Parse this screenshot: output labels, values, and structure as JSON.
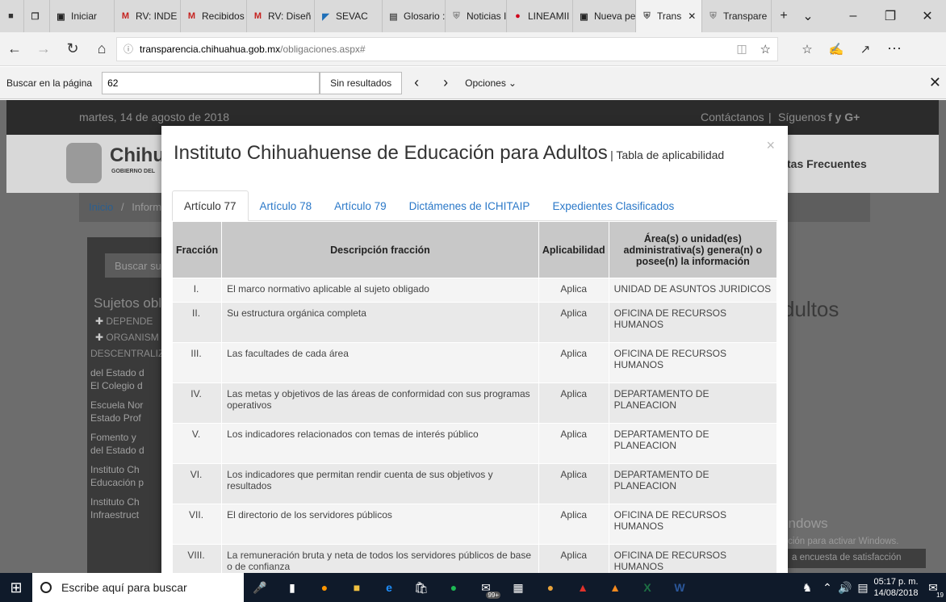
{
  "browser": {
    "tabs": [
      {
        "label": "",
        "icon": "tab-actions-icon",
        "color": "#333"
      },
      {
        "label": "",
        "icon": "back-tabs-icon",
        "color": "#333"
      },
      {
        "label": "Iniciar",
        "icon": "ichitaip-icon",
        "color": "#222"
      },
      {
        "label": "RV: INDE",
        "icon": "gmail-icon",
        "color": "#c5221f"
      },
      {
        "label": "Recibidos",
        "icon": "gmail-icon",
        "color": "#c5221f"
      },
      {
        "label": "RV: Diseñ",
        "icon": "gmail-icon",
        "color": "#c5221f"
      },
      {
        "label": "SEVAC",
        "icon": "sevac-icon",
        "color": "#1e6fb8"
      },
      {
        "label": "Glosario :",
        "icon": "page-icon",
        "color": "#555"
      },
      {
        "label": "Noticias I",
        "icon": "shield-icon",
        "color": "#888"
      },
      {
        "label": "LINEAMII",
        "icon": "red-circle-icon",
        "color": "#d0021b"
      },
      {
        "label": "Nueva pe",
        "icon": "ichitaip-icon",
        "color": "#222"
      },
      {
        "label": "Trans",
        "icon": "shield-icon",
        "color": "#555",
        "active": true
      },
      {
        "label": "Transpare",
        "icon": "shield-icon",
        "color": "#888"
      }
    ],
    "url_domain": "transparencia.chihuahua.gob.mx",
    "url_path": "/obligaciones.aspx#"
  },
  "findbar": {
    "label": "Buscar en la página",
    "value": "62",
    "result": "Sin resultados",
    "options": "Opciones"
  },
  "site": {
    "date": "martes, 14 de agosto de 2018",
    "contact": "Contáctanos",
    "follow": "Síguenos",
    "social": "f  y  G+",
    "brand": "Chihua",
    "brand_sub": "GOBIERNO DEL",
    "faq": "tas Frecuentes",
    "breadcrumb_home": "Inicio",
    "breadcrumb_sep": "/",
    "breadcrumb_next": "Inform",
    "search_placeholder": "Buscar su",
    "side_title": "Sujetos obl",
    "side_items": [
      "DEPENDE",
      "ORGANISM",
      "DESCENTRALIZ",
      "del Estado d",
      "El Colegio d",
      "Escuela Nor",
      "Estado Prof",
      "Fomento y",
      "del Estado d",
      "Instituto Ch",
      "Educación p",
      "Instituto Ch",
      "Infraestruct"
    ],
    "right_heading": "dultos",
    "watermark_title": "Activar Windows",
    "watermark_sub": "Ve a Configuración para activar Windows.",
    "survey": "a encuesta de satisfacción"
  },
  "modal": {
    "title": "Instituto Chihuahuense de Educación para Adultos",
    "subtitle": "| Tabla de aplicabilidad",
    "close": "×",
    "tabs": [
      "Artículo 77",
      "Artículo 78",
      "Artículo 79",
      "Dictámenes de ICHITAIP",
      "Expedientes Clasificados"
    ],
    "columns": [
      "Fracción",
      "Descripción fracción",
      "Aplicabilidad",
      "Área(s) o unidad(es) administrativa(s) genera(n) o posee(n) la información"
    ],
    "rows": [
      [
        "I.",
        "El marco normativo aplicable al sujeto obligado",
        "Aplica",
        "UNIDAD DE ASUNTOS JURIDICOS"
      ],
      [
        "II.",
        "Su estructura orgánica completa",
        "Aplica",
        "OFICINA DE RECURSOS HUMANOS"
      ],
      [
        "III.",
        "Las facultades de cada área",
        "Aplica",
        "OFICINA DE RECURSOS HUMANOS"
      ],
      [
        "IV.",
        "Las metas y objetivos de las áreas de conformidad con sus programas operativos",
        "Aplica",
        "DEPARTAMENTO DE PLANEACION"
      ],
      [
        "V.",
        "Los indicadores relacionados con temas de interés público",
        "Aplica",
        "DEPARTAMENTO DE PLANEACION"
      ],
      [
        "VI.",
        "Los indicadores que permitan rendir cuenta de sus objetivos y resultados",
        "Aplica",
        "DEPARTAMENTO DE PLANEACION"
      ],
      [
        "VII.",
        "El directorio de los servidores públicos",
        "Aplica",
        "OFICINA DE RECURSOS HUMANOS"
      ],
      [
        "VIII.",
        "La remuneración bruta y neta de todos los servidores públicos de base o de confianza",
        "Aplica",
        "OFICINA DE RECURSOS HUMANOS"
      ]
    ]
  },
  "taskbar": {
    "search": "Escribe aquí para buscar",
    "time": "05:17 p. m.",
    "date": "14/08/2018",
    "mail_badge": "99+",
    "notif_count": "19"
  }
}
